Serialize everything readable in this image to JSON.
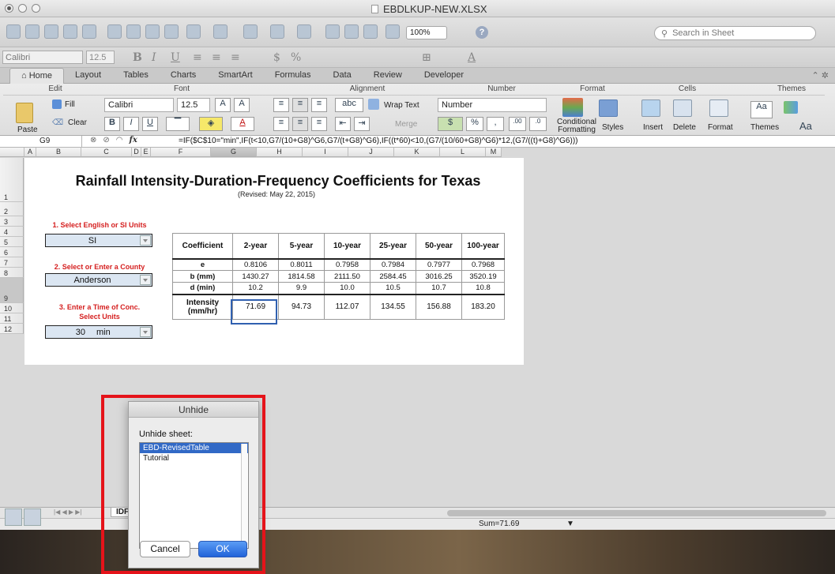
{
  "window": {
    "title": "EBDLKUP-NEW.XLSX"
  },
  "toolbar": {
    "zoom": "100%",
    "search_placeholder": "Search in Sheet"
  },
  "format_bar": {
    "font": "Calibri",
    "size": "12.5"
  },
  "ribbon": {
    "tabs": [
      "Home",
      "Layout",
      "Tables",
      "Charts",
      "SmartArt",
      "Formulas",
      "Data",
      "Review",
      "Developer"
    ],
    "groups": [
      "Edit",
      "Font",
      "Alignment",
      "Number",
      "Format",
      "Cells",
      "Themes"
    ],
    "fill_label": "Fill",
    "clear_label": "Clear",
    "paste_label": "Paste",
    "font": "Calibri",
    "size": "12.5",
    "wrap_text": "Wrap Text",
    "merge": "Merge",
    "number_format": "Number",
    "conditional_formatting": "Conditional Formatting",
    "styles": "Styles",
    "insert": "Insert",
    "delete": "Delete",
    "format": "Format",
    "themes": "Themes"
  },
  "formula_bar": {
    "cell": "G9",
    "formula": "=IF($C$10=\"min\",IF(t<10,G7/(10+G8)^G6,G7/(t+G8)^G6),IF((t*60)<10,(G7/(10/60+G8)^G6)*12,(G7/((t)+G8)^G6)))"
  },
  "columns": [
    {
      "label": "A",
      "w": 15
    },
    {
      "label": "B",
      "w": 57
    },
    {
      "label": "C",
      "w": 64
    },
    {
      "label": "D",
      "w": 12
    },
    {
      "label": "E",
      "w": 12
    },
    {
      "label": "F",
      "w": 76
    },
    {
      "label": "G",
      "w": 58
    },
    {
      "label": "H",
      "w": 58
    },
    {
      "label": "I",
      "w": 58
    },
    {
      "label": "J",
      "w": 58
    },
    {
      "label": "K",
      "w": 58
    },
    {
      "label": "L",
      "w": 58
    },
    {
      "label": "M",
      "w": 20
    }
  ],
  "rows": [
    "1",
    "2",
    "3",
    "4",
    "5",
    "6",
    "7",
    "8",
    "9",
    "10",
    "11",
    "12"
  ],
  "sheet": {
    "title": "Rainfall Intensity-Duration-Frequency Coefficients for Texas",
    "revised": "(Revised: May 22, 2015)",
    "step1": "1. Select English or SI Units",
    "units_value": "SI",
    "step2": "2. Select or Enter a County",
    "county_value": "Anderson",
    "step3_line1": "3. Enter a Time of Conc.",
    "step3_line2": "Select Units",
    "time_value": "30",
    "time_unit": "min"
  },
  "table": {
    "headers": [
      "Coefficient",
      "2-year",
      "5-year",
      "10-year",
      "25-year",
      "50-year",
      "100-year"
    ],
    "rows": [
      [
        "e",
        "0.8106",
        "0.8011",
        "0.7958",
        "0.7984",
        "0.7977",
        "0.7968"
      ],
      [
        "b (mm)",
        "1430.27",
        "1814.58",
        "2111.50",
        "2584.45",
        "3016.25",
        "3520.19"
      ],
      [
        "d (min)",
        "10.2",
        "9.9",
        "10.0",
        "10.5",
        "10.7",
        "10.8"
      ]
    ],
    "intensity_label_line1": "Intensity",
    "intensity_label_line2": "(mm/hr)",
    "intensity": [
      "71.69",
      "94.73",
      "112.07",
      "134.55",
      "156.88",
      "183.20"
    ]
  },
  "status": {
    "sheet_tab": "IDF",
    "sum": "Sum=71.69"
  },
  "dialog": {
    "title": "Unhide",
    "label": "Unhide sheet:",
    "items": [
      "EBD-RevisedTable",
      "Tutorial"
    ],
    "cancel": "Cancel",
    "ok": "OK"
  },
  "colors": {
    "accent": "#3169c6",
    "highlight": "#e5131a",
    "step_text": "#d52020"
  }
}
